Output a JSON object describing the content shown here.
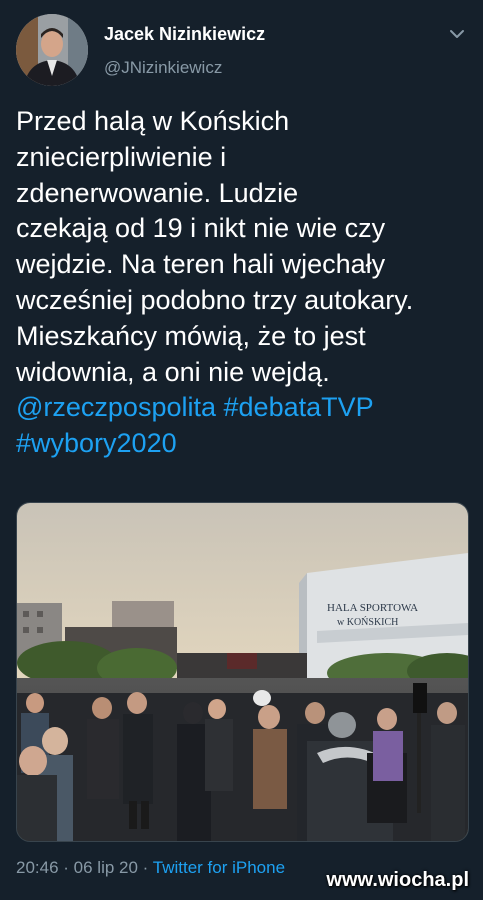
{
  "author": {
    "name": "Jacek Nizinkiewicz",
    "handle": "@JNizinkiewicz"
  },
  "tweet": {
    "lines": [
      "Przed halą w Końskich",
      "zniecierpliwienie i",
      "zdenerwowanie. Ludzie",
      "czekają od 19 i nikt nie wie czy",
      "wejdzie. Na teren hali wjechały",
      "wcześniej podobno trzy autokary.",
      "Mieszkańcy mówią, że to jest",
      "widownia, a oni nie wejdą."
    ],
    "mention": "@rzeczpospolita",
    "hashtag_1": "#debataTVP",
    "hashtag_2": "#wybory2020"
  },
  "photo": {
    "building_sign_line1": "HALA SPORTOWA",
    "building_sign_line2": "w KOŃSKICH"
  },
  "footer": {
    "time": "20:46",
    "separator": " · ",
    "date": "06 lip 20",
    "source": "Twitter for iPhone"
  },
  "watermark": "www.wiocha.pl",
  "colors": {
    "background": "#15202b",
    "link": "#1da1f2",
    "secondary_text": "#8899a6"
  }
}
